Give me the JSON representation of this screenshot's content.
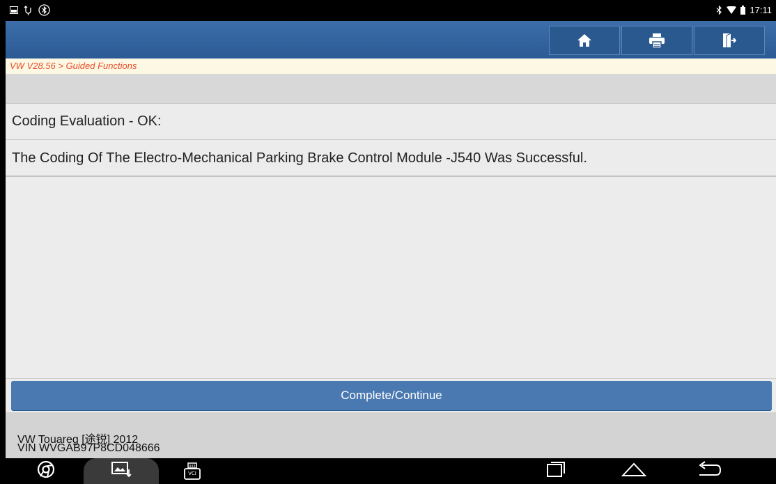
{
  "status_bar": {
    "left_icons": [
      "picture-icon",
      "usb-icon",
      "bluetooth-settings-icon"
    ],
    "right_icons": [
      "bluetooth-icon",
      "wifi-icon",
      "battery-icon"
    ],
    "time": "17:11"
  },
  "toolbar": {
    "buttons": [
      "home-icon",
      "print-icon",
      "exit-icon"
    ]
  },
  "breadcrumb": "VW V28.56 > Guided Functions",
  "content": {
    "line1": "Coding Evaluation - OK:",
    "line2": "The Coding Of The Electro-Mechanical Parking Brake Control Module -J540 Was Successful."
  },
  "action": {
    "complete_label": "Complete/Continue"
  },
  "vehicle": {
    "model": "VW Touareg [途锐] 2012",
    "vin": "VIN WVGAB97P8CD048666"
  },
  "nav_bar": {
    "left": [
      "chrome-icon",
      "screenshot-icon",
      "vci-icon"
    ],
    "vci_label": "VCI",
    "right": [
      "recent-apps-icon",
      "home-nav-icon",
      "back-icon"
    ]
  },
  "colors": {
    "header": "#2f5f99",
    "breadcrumb_text": "#e84c2a",
    "button": "#4a78b0"
  }
}
